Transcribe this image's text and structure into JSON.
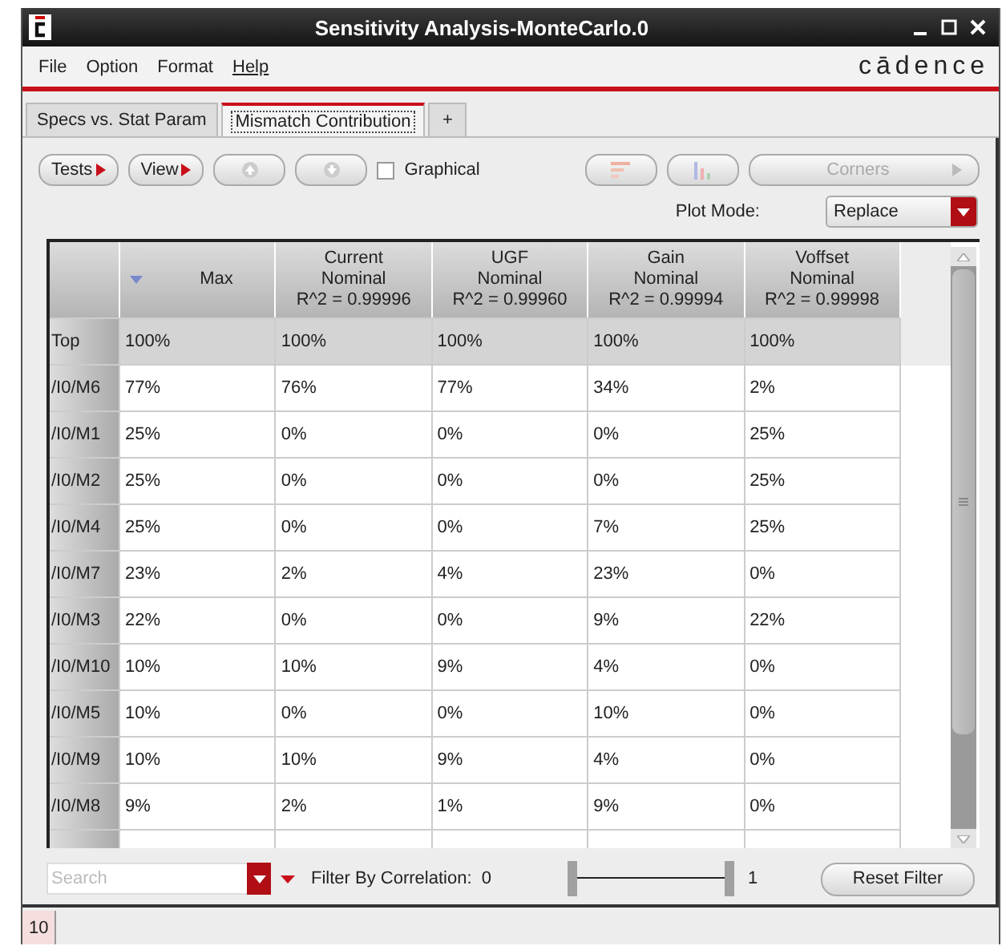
{
  "window": {
    "title": "Sensitivity Analysis-MonteCarlo.0"
  },
  "menu": [
    {
      "label": "File",
      "mnemonic": false
    },
    {
      "label": "Option",
      "mnemonic": false
    },
    {
      "label": "Format",
      "mnemonic": false
    },
    {
      "label": "Help",
      "mnemonic": true
    }
  ],
  "brand": "cādence",
  "tabs": [
    {
      "label": "Specs vs. Stat Param",
      "selected": false
    },
    {
      "label": "Mismatch Contribution",
      "selected": true
    }
  ],
  "add_tab": "+",
  "toolbar": [
    {
      "kind": "menu",
      "label": "Tests",
      "disabled": false
    },
    {
      "kind": "menu",
      "label": "View",
      "disabled": false
    },
    {
      "kind": "up",
      "disabled": true
    },
    {
      "kind": "down",
      "disabled": true
    },
    {
      "kind": "checkbox",
      "label": "Graphical",
      "checked": false
    },
    {
      "kind": "bars",
      "disabled": true
    },
    {
      "kind": "columns",
      "disabled": true
    },
    {
      "kind": "wide",
      "label": "Corners",
      "disabled": true
    }
  ],
  "plot_mode": {
    "label": "Plot Mode:",
    "value": "Replace"
  },
  "table": {
    "columns": [
      {
        "lines": [
          "Max"
        ],
        "sorted": true
      },
      {
        "lines": [
          "Current",
          "Nominal",
          "R^2 = 0.99996"
        ],
        "sorted": false
      },
      {
        "lines": [
          "UGF",
          "Nominal",
          "R^2 = 0.99960"
        ],
        "sorted": false
      },
      {
        "lines": [
          "Gain",
          "Nominal",
          "R^2 = 0.99994"
        ],
        "sorted": false
      },
      {
        "lines": [
          "Voffset",
          "Nominal",
          "R^2 = 0.99998"
        ],
        "sorted": false
      }
    ],
    "rows": [
      {
        "name": "Top",
        "highlighted": true,
        "cells": [
          "100%",
          "100%",
          "100%",
          "100%",
          "100%"
        ]
      },
      {
        "name": "/I0/M6",
        "highlighted": false,
        "cells": [
          "77%",
          "76%",
          "77%",
          "34%",
          "2%"
        ]
      },
      {
        "name": "/I0/M1",
        "highlighted": false,
        "cells": [
          "25%",
          "0%",
          "0%",
          "0%",
          "25%"
        ]
      },
      {
        "name": "/I0/M2",
        "highlighted": false,
        "cells": [
          "25%",
          "0%",
          "0%",
          "0%",
          "25%"
        ]
      },
      {
        "name": "/I0/M4",
        "highlighted": false,
        "cells": [
          "25%",
          "0%",
          "0%",
          "7%",
          "25%"
        ]
      },
      {
        "name": "/I0/M7",
        "highlighted": false,
        "cells": [
          "23%",
          "2%",
          "4%",
          "23%",
          "0%"
        ]
      },
      {
        "name": "/I0/M3",
        "highlighted": false,
        "cells": [
          "22%",
          "0%",
          "0%",
          "9%",
          "22%"
        ]
      },
      {
        "name": "/I0/M10",
        "highlighted": false,
        "cells": [
          "10%",
          "10%",
          "9%",
          "4%",
          "0%"
        ]
      },
      {
        "name": "/I0/M5",
        "highlighted": false,
        "cells": [
          "10%",
          "0%",
          "0%",
          "10%",
          "0%"
        ]
      },
      {
        "name": "/I0/M9",
        "highlighted": false,
        "cells": [
          "10%",
          "10%",
          "9%",
          "4%",
          "0%"
        ]
      },
      {
        "name": "/I0/M8",
        "highlighted": false,
        "cells": [
          "9%",
          "2%",
          "1%",
          "9%",
          "0%"
        ]
      }
    ]
  },
  "filter": {
    "search_placeholder": "Search",
    "label": "Filter By Correlation:",
    "min": "0",
    "max": "1",
    "low_thumb": {
      "level": 0
    },
    "high_thumb": {
      "level": 1
    },
    "reset": "Reset Filter"
  },
  "status": {
    "count": "10"
  }
}
